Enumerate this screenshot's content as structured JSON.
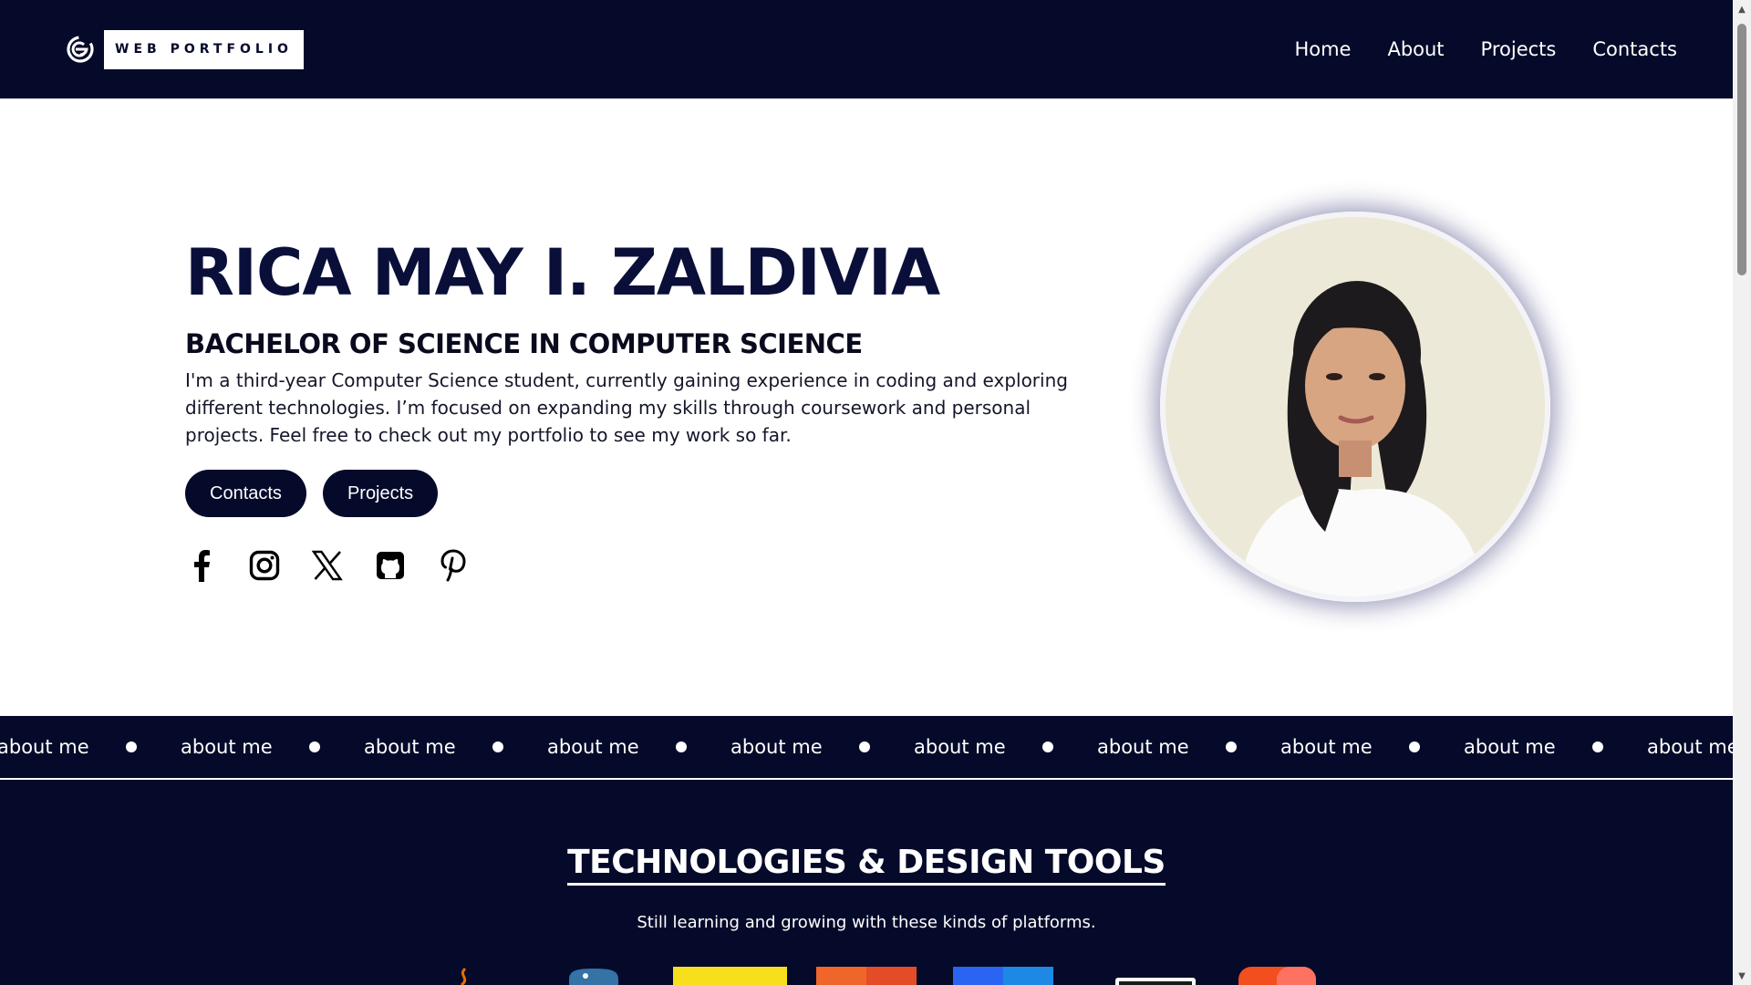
{
  "header": {
    "brand_text": "WEB PORTFOLIO",
    "brand_icon": "g-logo-icon",
    "nav": [
      "Home",
      "About",
      "Projects",
      "Contacts"
    ]
  },
  "hero": {
    "name": "RICA MAY I. ZALDIVIA",
    "degree": "BACHELOR OF SCIENCE IN COMPUTER SCIENCE",
    "bio": "I'm a third-year Computer Science student, currently gaining experience in coding and exploring different technologies. I’m focused on expanding my skills through coursework and personal projects. Feel free to check out my portfolio to see my work so far.",
    "buttons": [
      "Contacts",
      "Projects"
    ],
    "socials": [
      "facebook-icon",
      "instagram-icon",
      "x-icon",
      "github-icon",
      "pinterest-icon"
    ]
  },
  "marquee": {
    "items": [
      "about me",
      "about me",
      "about me",
      "about me",
      "about me",
      "about me",
      "about me",
      "about me",
      "about me",
      "about me"
    ]
  },
  "tech": {
    "title": "TECHNOLOGIES & DESIGN TOOLS",
    "subtitle": "Still learning and growing with these kinds of platforms.",
    "icons": [
      "java-icon",
      "python-icon",
      "javascript-icon",
      "html5-icon",
      "css3-icon",
      "vscode-icon",
      "figma-icon"
    ]
  },
  "colors": {
    "navy": "#050a2a",
    "text_dark": "#0a0f3a",
    "white": "#ffffff"
  }
}
